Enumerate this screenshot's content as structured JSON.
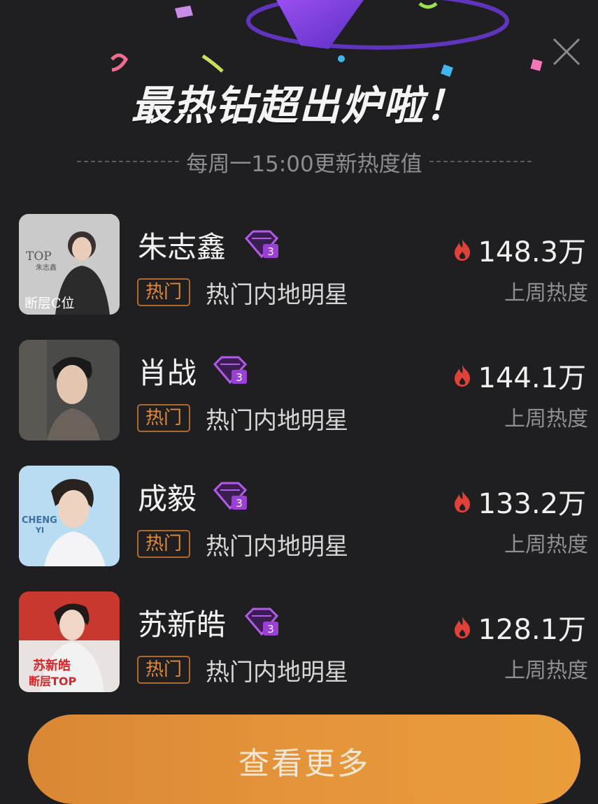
{
  "header": {
    "title": "最热钻超出炉啦！",
    "subtitle": "每周一15:00更新热度值"
  },
  "ranking": [
    {
      "name": "朱志鑫",
      "badge_level": "3",
      "tag": "热门",
      "category": "热门内地明星",
      "heat": "148.3万",
      "heat_label": "上周热度",
      "avatar_text": [
        "TOP",
        "朱志鑫",
        "断层C位"
      ]
    },
    {
      "name": "肖战",
      "badge_level": "3",
      "tag": "热门",
      "category": "热门内地明星",
      "heat": "144.1万",
      "heat_label": "上周热度",
      "avatar_text": []
    },
    {
      "name": "成毅",
      "badge_level": "3",
      "tag": "热门",
      "category": "热门内地明星",
      "heat": "133.2万",
      "heat_label": "上周热度",
      "avatar_text": [
        "CHENG",
        "YI"
      ]
    },
    {
      "name": "苏新皓",
      "badge_level": "3",
      "tag": "热门",
      "category": "热门内地明星",
      "heat": "128.1万",
      "heat_label": "上周热度",
      "avatar_text": [
        "苏新皓",
        "断层TOP"
      ]
    }
  ],
  "more_button": {
    "label": "查看更多"
  },
  "colors": {
    "background": "#1f1f21",
    "tag_orange": "#e38a3a",
    "flame_red": "#e0423a",
    "badge_purple": "#a24bd8",
    "button_orange": "#e5943a"
  },
  "icons": {
    "close": "close-icon",
    "flame": "flame-icon",
    "badge": "diamond-badge-icon"
  }
}
